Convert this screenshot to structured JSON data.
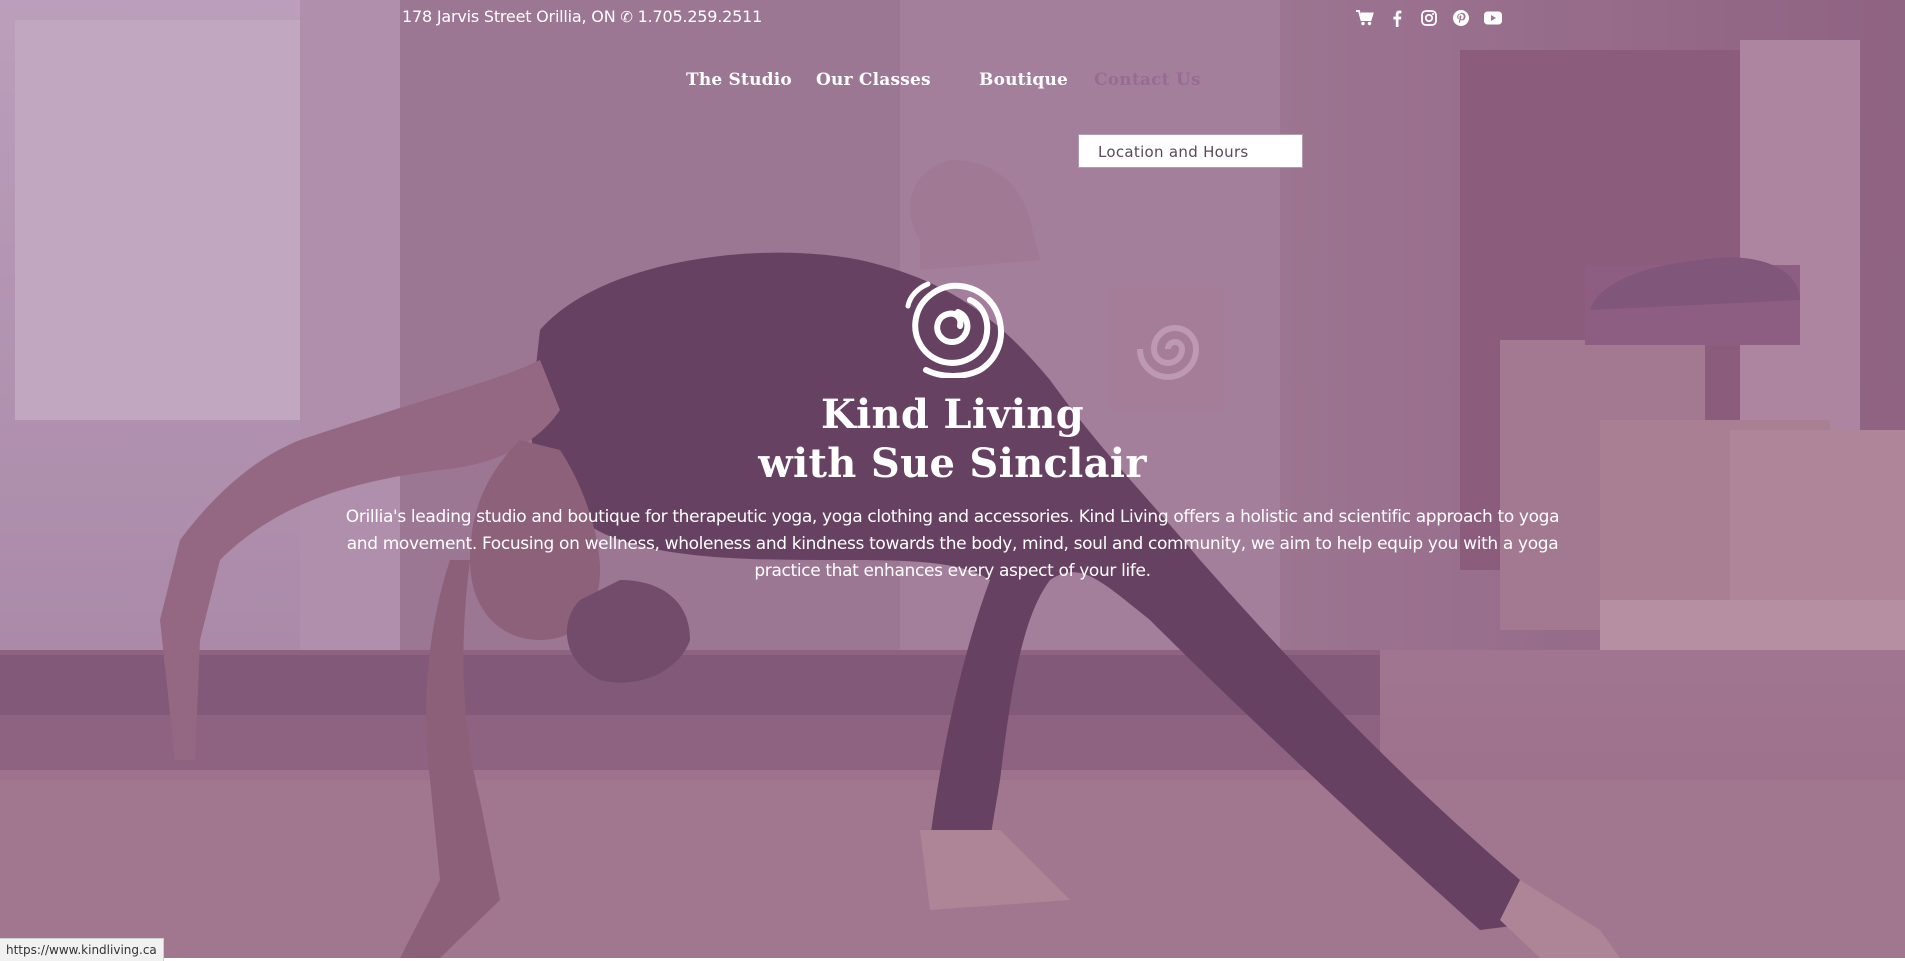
{
  "topbar": {
    "address": "178 Jarvis Street Orillia, ON",
    "phone_icon": "phone-icon",
    "phone": "1.705.259.2511",
    "social_icons": [
      "cart-icon",
      "facebook-icon",
      "instagram-icon",
      "pinterest-icon",
      "youtube-icon"
    ]
  },
  "nav": {
    "items": [
      {
        "label": "The Studio"
      },
      {
        "label": "Our Classes"
      },
      {
        "label": "Boutique"
      },
      {
        "label": "Contact Us"
      }
    ],
    "active": "Contact Us",
    "dropdown": {
      "items": [
        {
          "label": "Location and Hours"
        }
      ]
    }
  },
  "hero": {
    "logo_icon": "spiral-logo-icon",
    "title_line1": "Kind Living",
    "title_line2": "with Sue Sinclair",
    "description": "Orillia's leading studio and boutique for therapeutic yoga, yoga clothing and accessories. Kind Living offers a holistic and scientific approach to yoga and movement. Focusing on wellness, wholeness and kindness towards the body, mind, soul and community, we aim to help equip you with a yoga practice that enhances every aspect of your life."
  },
  "status_bar": {
    "url": "https://www.kindliving.ca"
  },
  "colors": {
    "overlay": "#9a7691",
    "active_nav": "#9a6a92",
    "text": "#ffffff"
  }
}
